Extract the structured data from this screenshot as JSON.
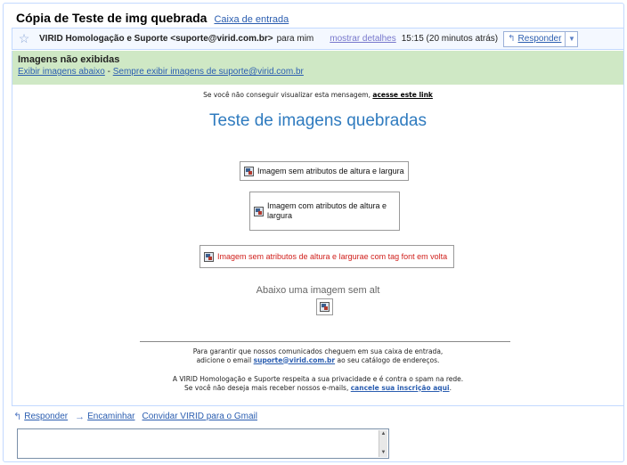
{
  "title": {
    "subject": "Cópia de Teste de img quebrada",
    "label": "Caixa de entrada"
  },
  "header": {
    "sender": "VIRID Homologação e Suporte <suporte@virid.com.br>",
    "to": "para mim",
    "details_link": "mostrar detalhes",
    "time": "15:15 (20 minutos atrás)",
    "reply_label": "Responder"
  },
  "warning": {
    "title": "Imagens não exibidas",
    "show_below": "Exibir imagens abaixo",
    "separator": "-",
    "always_show": "Sempre exibir imagens de suporte@virid.com.br"
  },
  "email": {
    "notice_prefix": "Se você não conseguir visualizar esta mensagem, ",
    "notice_link": "acesse este link",
    "heading": "Teste de imagens quebradas",
    "img1_alt": "Imagem sem atributos de altura e largura",
    "img2_alt": "Imagem com atributos de altura e largura",
    "img3_alt": "Imagem sem atributos de altura e largurae com tag font em volta",
    "alt_caption": "Abaixo uma imagem sem alt",
    "footer": {
      "line1": "Para garantir que nossos comunicados cheguem em sua caixa de entrada,",
      "line2_prefix": "adicione o email ",
      "line2_email": "suporte@virid.com.br",
      "line2_suffix": " ao seu catálogo de endereços.",
      "line3": "A VIRID Homologação e Suporte respeita a sua privacidade e é contra o spam na rede.",
      "line4_prefix": "Se você não deseja mais receber nossos e-mails, ",
      "line4_link": "cancele sua inscrição aqui",
      "line4_suffix": "."
    }
  },
  "actions": {
    "reply": "Responder",
    "forward": "Encaminhar",
    "invite": "Convidar VIRID para o Gmail"
  },
  "icons": {
    "star": "star-icon",
    "reply": "reply-arrow-icon",
    "forward": "forward-arrow-icon",
    "broken_image": "broken-image-icon"
  },
  "colors": {
    "warning_bg": "#cfe8c5",
    "link": "#2a5db0",
    "heading": "#2f7bbf",
    "red_text": "#d0201c"
  }
}
